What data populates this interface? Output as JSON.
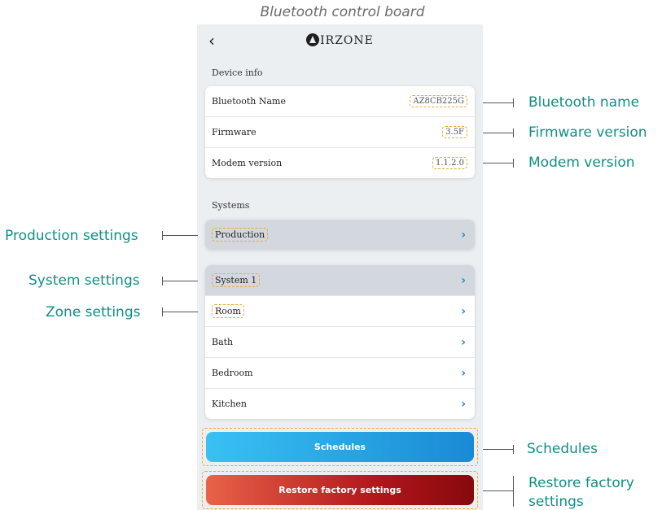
{
  "caption": "Bluetooth control board",
  "header": {
    "back_icon": "chevron-left-icon",
    "brand": "IRZONE"
  },
  "device_info": {
    "title": "Device info",
    "rows": [
      {
        "label": "Bluetooth Name",
        "value": "AZ8CB225G"
      },
      {
        "label": "Firmware",
        "value": "3.5F"
      },
      {
        "label": "Modem version",
        "value": "1.1.2.0"
      }
    ]
  },
  "systems": {
    "title": "Systems",
    "production": "Production",
    "system": "System 1",
    "zones": [
      "Room",
      "Bath",
      "Bedroom",
      "Kitchen"
    ]
  },
  "buttons": {
    "schedules": "Schedules",
    "restore": "Restore factory settings"
  },
  "annotations": {
    "bluetooth_name": "Bluetooth name",
    "firmware_version": "Firmware version",
    "modem_version": "Modem version",
    "production_settings": "Production settings",
    "system_settings": "System settings",
    "zone_settings": "Zone settings",
    "schedules": "Schedules",
    "restore_line1": "Restore factory",
    "restore_line2": "settings"
  },
  "colors": {
    "annotation": "#0f8f86",
    "highlight": "#f0a830",
    "chevron": "#1f86c7"
  }
}
